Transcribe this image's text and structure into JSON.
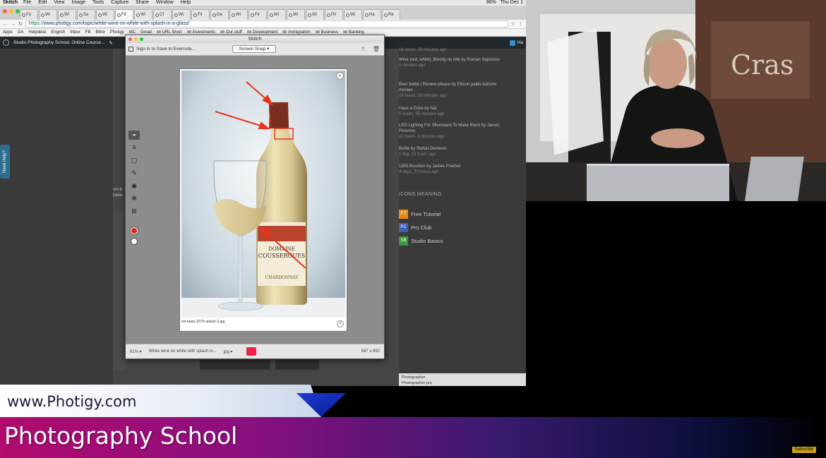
{
  "menubar": {
    "app": "Skitch",
    "items": [
      "File",
      "Edit",
      "View",
      "Image",
      "Tools",
      "Capture",
      "Share",
      "Window",
      "Help"
    ],
    "battery": "96%",
    "clock": "Thu Dec 1"
  },
  "tabs": [
    "Fo",
    "Wi",
    "Wi",
    "Sa",
    "Wi",
    "Fir",
    "Wi",
    "Cf",
    "Wi",
    "Fir",
    "Ge",
    "Wi",
    "Fir",
    "Wi",
    "Wi",
    "Wi",
    "Pri",
    "Wi",
    "Ha",
    "Re"
  ],
  "address": {
    "url_prefix": "https://",
    "url_rest": "www.photigy.com/topic/white-wine-on-white-with-splash-in-a-glass/"
  },
  "bookmarks": [
    "Apps",
    "GA",
    "Helpdesk",
    "English",
    "Inbox",
    "FB",
    "Bitrix",
    "Photigy",
    "MC",
    "Gmail",
    "URL Short",
    "Investments",
    "Our stuff",
    "Development",
    "Immigration",
    "Business",
    "Banking"
  ],
  "wpbar": {
    "site": "Studio Photography School: Online Course...",
    "howdy": "Ha"
  },
  "need_help": "Need Help?",
  "feed": [
    {
      "title": "",
      "meta": "16 hours, 38 minutes ago"
    },
    {
      "title": "Wine (red, white), Bloody on bite by  Roman Sapronov",
      "meta": "5 minutes ago"
    },
    {
      "title": "Beer bottle | Review please by  Ellison pablo dafonte moraes",
      "meta": "16 hours, 53 minutes ago"
    },
    {
      "title": "Have a Coke by  Nat",
      "meta": "5 hours, 35 minutes ago"
    },
    {
      "title": "LED Lighting For Silverware To Make Black by  James Pisturino",
      "meta": "23 hours, 5 minutes ago"
    },
    {
      "title": "Bottle by  Stefan Declerck",
      "meta": "1 day, 23 hours ago"
    },
    {
      "title": "1805 Bourbon by  James Prechel",
      "meta": "4 days, 23 hours ago"
    }
  ],
  "icons_meaning": {
    "heading": "Icons meaning",
    "items": [
      {
        "badge": "FT",
        "label": "Free Tutorial",
        "color": "#e98a1c"
      },
      {
        "badge": "PC",
        "label": "Pro Club",
        "color": "#3f5fb5"
      },
      {
        "badge": "SB",
        "label": "Studio Basics",
        "color": "#3b9a3d"
      }
    ]
  },
  "skitch": {
    "title": "Skitch",
    "signin": "Sign in to Save to Evernote...",
    "screen_snap": "Screen Snap",
    "zoom": "81%",
    "filename": "White wine on white with splash in...",
    "format": "jpg",
    "dimensions": "587 x 892",
    "preview_caption": "vin-blanc-2075-splash-2.jpg"
  },
  "behind_snippet": {
    "line1": "vin-b",
    "line2": "[dela"
  },
  "strip": {
    "row1": "Photographer",
    "row2": "Photographer pro"
  },
  "lower_third": {
    "url": "www.Photigy.com",
    "title": "Photography School",
    "subscribe": "Subscribe"
  },
  "video": {
    "sign_text": "Cras"
  }
}
